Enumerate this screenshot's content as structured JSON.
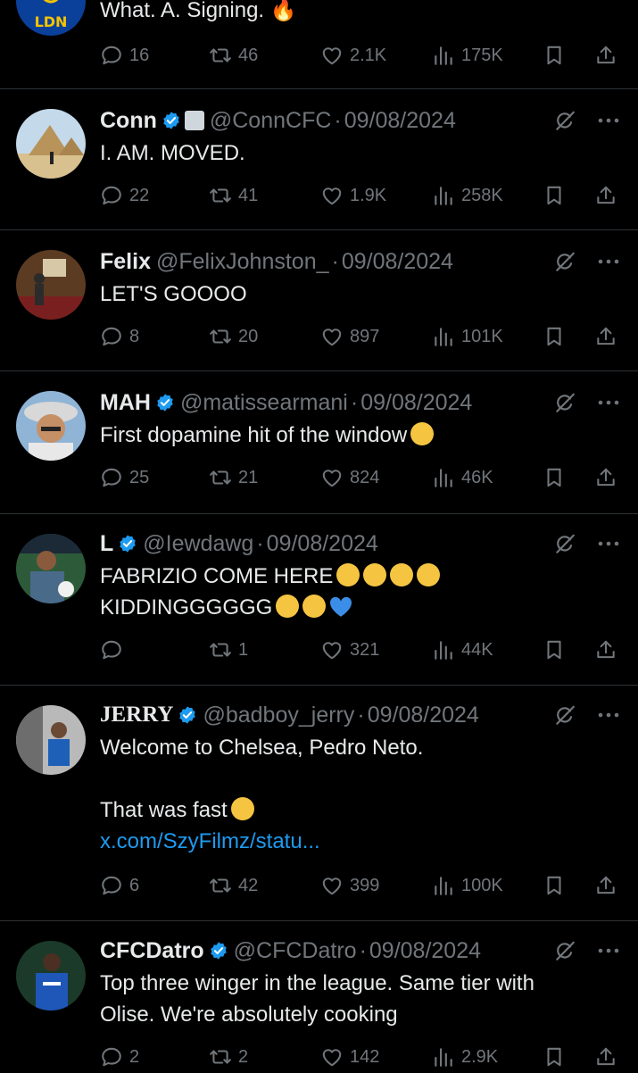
{
  "tweets": [
    {
      "id": "ldn",
      "name": "",
      "handle": "",
      "date": "",
      "avatar_label": "LDN",
      "lines": [
        "What. A. Signing. 🔥"
      ],
      "reply": "16",
      "retweet": "46",
      "like": "2.1K",
      "views": "175K"
    },
    {
      "id": "conn",
      "name": "Conn",
      "handle": "@ConnCFC",
      "date": "09/08/2024",
      "lines": [
        "I. AM. MOVED."
      ],
      "reply": "22",
      "retweet": "41",
      "like": "1.9K",
      "views": "258K"
    },
    {
      "id": "felix",
      "name": "Felix",
      "handle": "@FelixJohnston_",
      "date": "09/08/2024",
      "lines": [
        "LET'S GOOOO"
      ],
      "reply": "8",
      "retweet": "20",
      "like": "897",
      "views": "101K"
    },
    {
      "id": "mah",
      "name": "MAH",
      "handle": "@matissearmani",
      "date": "09/08/2024",
      "lines": [
        "First dopamine hit of the window"
      ],
      "reply": "25",
      "retweet": "21",
      "like": "824",
      "views": "46K"
    },
    {
      "id": "l",
      "name": "L",
      "handle": "@Iewdawg",
      "date": "09/08/2024",
      "lines": [
        "FABRIZIO COME HERE",
        "KIDDINGGGGGG"
      ],
      "reply": "",
      "retweet": "1",
      "like": "321",
      "views": "44K"
    },
    {
      "id": "jerry",
      "name": "JERRY",
      "handle": "@badboy_jerry",
      "date": "09/08/2024",
      "lines": [
        "Welcome to Chelsea, Pedro Neto.",
        "That was fast"
      ],
      "link": "x.com/SzyFilmz/statu...",
      "reply": "6",
      "retweet": "42",
      "like": "399",
      "views": "100K"
    },
    {
      "id": "cfcdatro",
      "name": "CFCDatro",
      "handle": "@CFCDatro",
      "date": "09/08/2024",
      "lines": [
        "Top three winger in the league. Same tier with",
        "Olise. We're absolutely cooking"
      ],
      "reply": "2",
      "retweet": "2",
      "like": "142",
      "views": "2.9K"
    }
  ],
  "colors": {
    "background": "#000000",
    "text": "#e7e9ea",
    "muted": "#71767b",
    "link": "#1d9bf0",
    "verified": "#1d9bf0",
    "divider": "#2f3336"
  },
  "icons": [
    "reply-icon",
    "retweet-icon",
    "like-icon",
    "views-icon",
    "bookmark-icon",
    "share-icon",
    "grok-icon",
    "more-icon",
    "verified-badge-icon"
  ]
}
